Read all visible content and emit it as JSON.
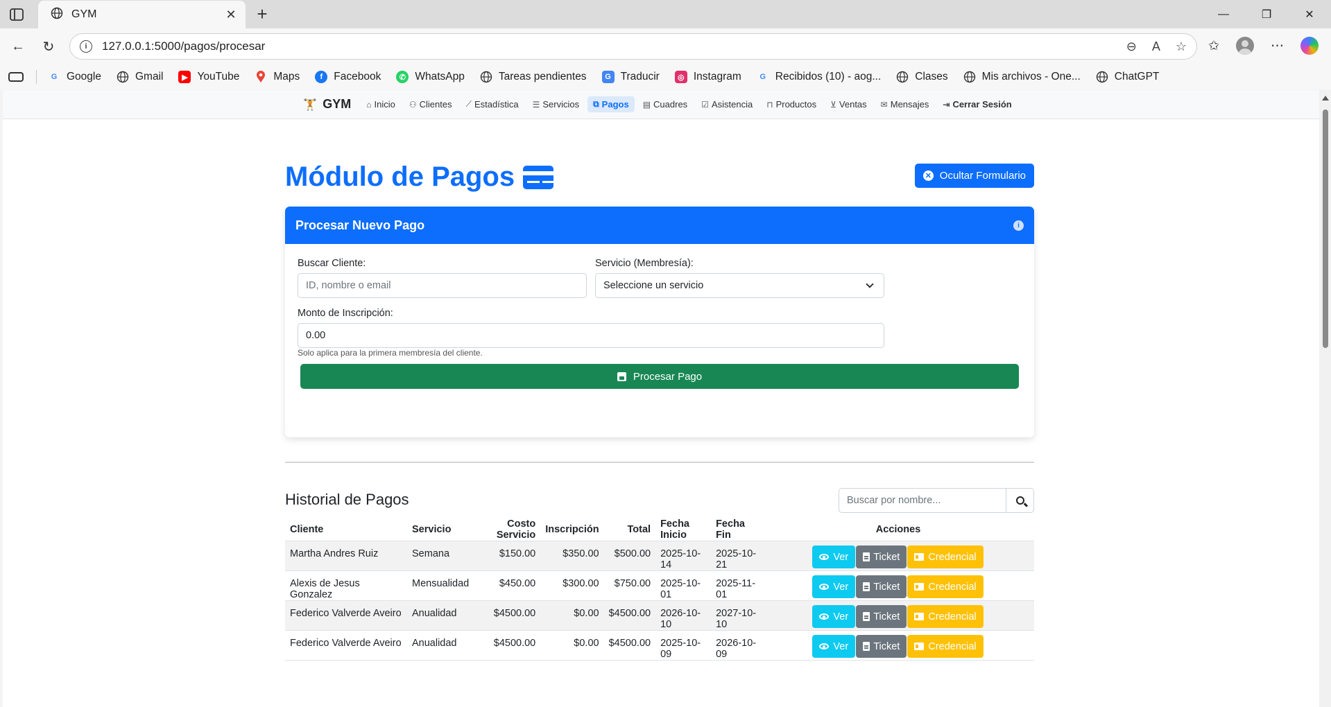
{
  "browser": {
    "tab_title": "GYM",
    "url": "127.0.0.1:5000/pagos/procesar",
    "bookmarks": [
      {
        "label": "Google",
        "icon": "google-icon",
        "color": "#4285f4"
      },
      {
        "label": "Gmail",
        "icon": "globe-icon",
        "color": "#333333"
      },
      {
        "label": "YouTube",
        "icon": "youtube-icon",
        "color": "#ff0000"
      },
      {
        "label": "Maps",
        "icon": "maps-pin-icon",
        "color": "#34a853"
      },
      {
        "label": "Facebook",
        "icon": "facebook-icon",
        "color": "#1877f2"
      },
      {
        "label": "WhatsApp",
        "icon": "whatsapp-icon",
        "color": "#25d366"
      },
      {
        "label": "Tareas pendientes",
        "icon": "globe-icon",
        "color": "#333333"
      },
      {
        "label": "Traducir",
        "icon": "translate-icon",
        "color": "#4285f4"
      },
      {
        "label": "Instagram",
        "icon": "instagram-icon",
        "color": "#e1306c"
      },
      {
        "label": "Recibidos (10) - aog...",
        "icon": "google-icon",
        "color": "#4285f4"
      },
      {
        "label": "Clases",
        "icon": "globe-icon",
        "color": "#333333"
      },
      {
        "label": "Mis archivos - One...",
        "icon": "globe-icon",
        "color": "#333333"
      },
      {
        "label": "ChatGPT",
        "icon": "globe-icon",
        "color": "#333333"
      }
    ]
  },
  "app_nav": {
    "brand": "GYM",
    "links": [
      {
        "label": "Inicio",
        "icon": "house-icon"
      },
      {
        "label": "Clientes",
        "icon": "people-icon"
      },
      {
        "label": "Estadística",
        "icon": "chart-icon"
      },
      {
        "label": "Servicios",
        "icon": "list-icon"
      },
      {
        "label": "Pagos",
        "icon": "payment-icon",
        "active": true
      },
      {
        "label": "Cuadres",
        "icon": "register-icon"
      },
      {
        "label": "Asistencia",
        "icon": "calendar-check-icon"
      },
      {
        "label": "Productos",
        "icon": "basket-icon"
      },
      {
        "label": "Ventas",
        "icon": "cart-icon"
      },
      {
        "label": "Mensajes",
        "icon": "envelope-icon"
      },
      {
        "label": "Cerrar Sesión",
        "icon": "logout-icon"
      }
    ]
  },
  "page": {
    "title": "Módulo de Pagos",
    "hide_form_button": "Ocultar Formulario"
  },
  "form": {
    "header": "Procesar Nuevo Pago",
    "client_label": "Buscar Cliente:",
    "client_placeholder": "ID, nombre o email",
    "service_label": "Servicio (Membresía):",
    "service_selected": "Seleccione un servicio",
    "amount_label": "Monto de Inscripción:",
    "amount_value": "0.00",
    "amount_help": "Solo aplica para la primera membresía del cliente.",
    "submit_label": "Procesar Pago"
  },
  "history": {
    "title": "Historial de Pagos",
    "search_placeholder": "Buscar por nombre...",
    "columns": [
      "Cliente",
      "Servicio",
      "Costo Servicio",
      "Inscripción",
      "Total",
      "Fecha Inicio",
      "Fecha Fin",
      "Acciones"
    ],
    "action_labels": {
      "view": "Ver",
      "ticket": "Ticket",
      "credential": "Credencial"
    },
    "rows": [
      {
        "cliente": "Martha Andres Ruiz",
        "servicio": "Semana",
        "costo": "$150.00",
        "inscripcion": "$350.00",
        "total": "$500.00",
        "inicio": "2025-10-14",
        "fin": "2025-10-21"
      },
      {
        "cliente": "Alexis de Jesus Gonzalez",
        "servicio": "Mensualidad",
        "costo": "$450.00",
        "inscripcion": "$300.00",
        "total": "$750.00",
        "inicio": "2025-10-01",
        "fin": "2025-11-01"
      },
      {
        "cliente": "Federico Valverde Aveiro",
        "servicio": "Anualidad",
        "costo": "$4500.00",
        "inscripcion": "$0.00",
        "total": "$4500.00",
        "inicio": "2026-10-10",
        "fin": "2027-10-10"
      },
      {
        "cliente": "Federico Valverde Aveiro",
        "servicio": "Anualidad",
        "costo": "$4500.00",
        "inscripcion": "$0.00",
        "total": "$4500.00",
        "inicio": "2025-10-09",
        "fin": "2026-10-09"
      }
    ]
  }
}
